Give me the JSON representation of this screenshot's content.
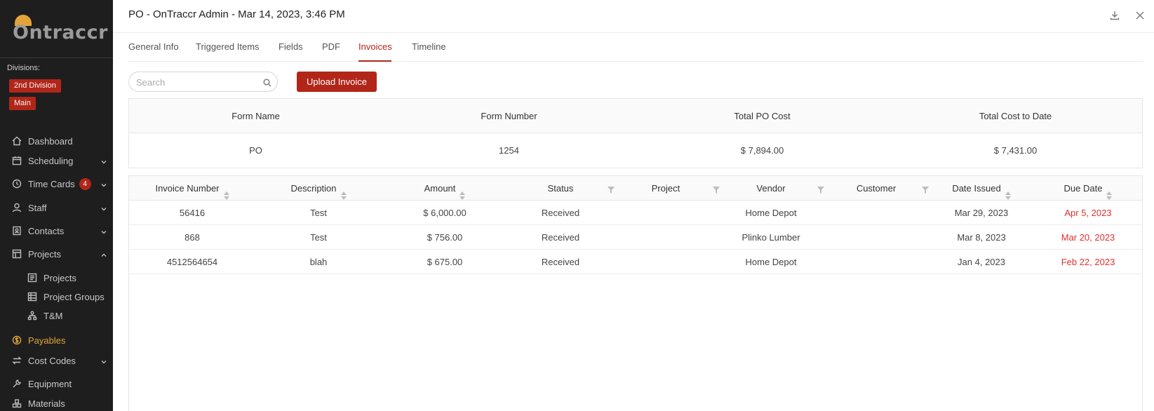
{
  "sidebar": {
    "logo_text": "Ontraccr",
    "divisions_label": "Divisions:",
    "divisions": [
      "2nd Division",
      "Main"
    ],
    "items": [
      {
        "label": "Dashboard",
        "icon": "home-icon"
      },
      {
        "label": "Scheduling",
        "icon": "calendar-icon"
      },
      {
        "label": "Time Cards",
        "icon": "clock-icon",
        "badge": "4"
      },
      {
        "label": "Staff",
        "icon": "user-icon"
      },
      {
        "label": "Contacts",
        "icon": "contacts-icon"
      },
      {
        "label": "Projects",
        "icon": "projects-icon"
      },
      {
        "label": "Projects",
        "icon": "project-icon"
      },
      {
        "label": "Project Groups",
        "icon": "project-groups-icon"
      },
      {
        "label": "T&M",
        "icon": "tm-icon"
      },
      {
        "label": "Payables",
        "icon": "dollar-icon"
      },
      {
        "label": "Cost Codes",
        "icon": "cost-codes-icon"
      },
      {
        "label": "Equipment",
        "icon": "wrench-icon"
      },
      {
        "label": "Materials",
        "icon": "materials-icon"
      }
    ],
    "active": "Payables",
    "accent_color": "#e2a43a"
  },
  "drawer": {
    "title": "PO - OnTraccr Admin - Mar 14, 2023, 3:46 PM",
    "tabs": [
      "General Info",
      "Triggered Items",
      "Fields",
      "PDF",
      "Invoices",
      "Timeline"
    ],
    "active_tab": "Invoices",
    "search_placeholder": "Search",
    "upload_label": "Upload Invoice",
    "brand_color": "#b2261a"
  },
  "summary": {
    "headers": [
      "Form Name",
      "Form Number",
      "Total PO Cost",
      "Total Cost to Date"
    ],
    "row": [
      "PO",
      "1254",
      "$ 7,894.00",
      "$ 7,431.00"
    ]
  },
  "invoices": {
    "headers": [
      "Invoice Number",
      "Description",
      "Amount",
      "Status",
      "Project",
      "Vendor",
      "Customer",
      "Date Issued",
      "Due Date"
    ],
    "rows": [
      {
        "number": "56416",
        "description": "Test",
        "amount": "$ 6,000.00",
        "status": "Received",
        "project": "",
        "vendor": "Home Depot",
        "customer": "",
        "issued": "Mar 29, 2023",
        "due": "Apr 5, 2023"
      },
      {
        "number": "868",
        "description": "Test",
        "amount": "$ 756.00",
        "status": "Received",
        "project": "",
        "vendor": "Plinko Lumber",
        "customer": "",
        "issued": "Mar 8, 2023",
        "due": "Mar 20, 2023"
      },
      {
        "number": "4512564654",
        "description": "blah",
        "amount": "$ 675.00",
        "status": "Received",
        "project": "",
        "vendor": "Home Depot",
        "customer": "",
        "issued": "Jan 4, 2023",
        "due": "Feb 22, 2023"
      }
    ],
    "overdue_color": "#e0302f"
  }
}
